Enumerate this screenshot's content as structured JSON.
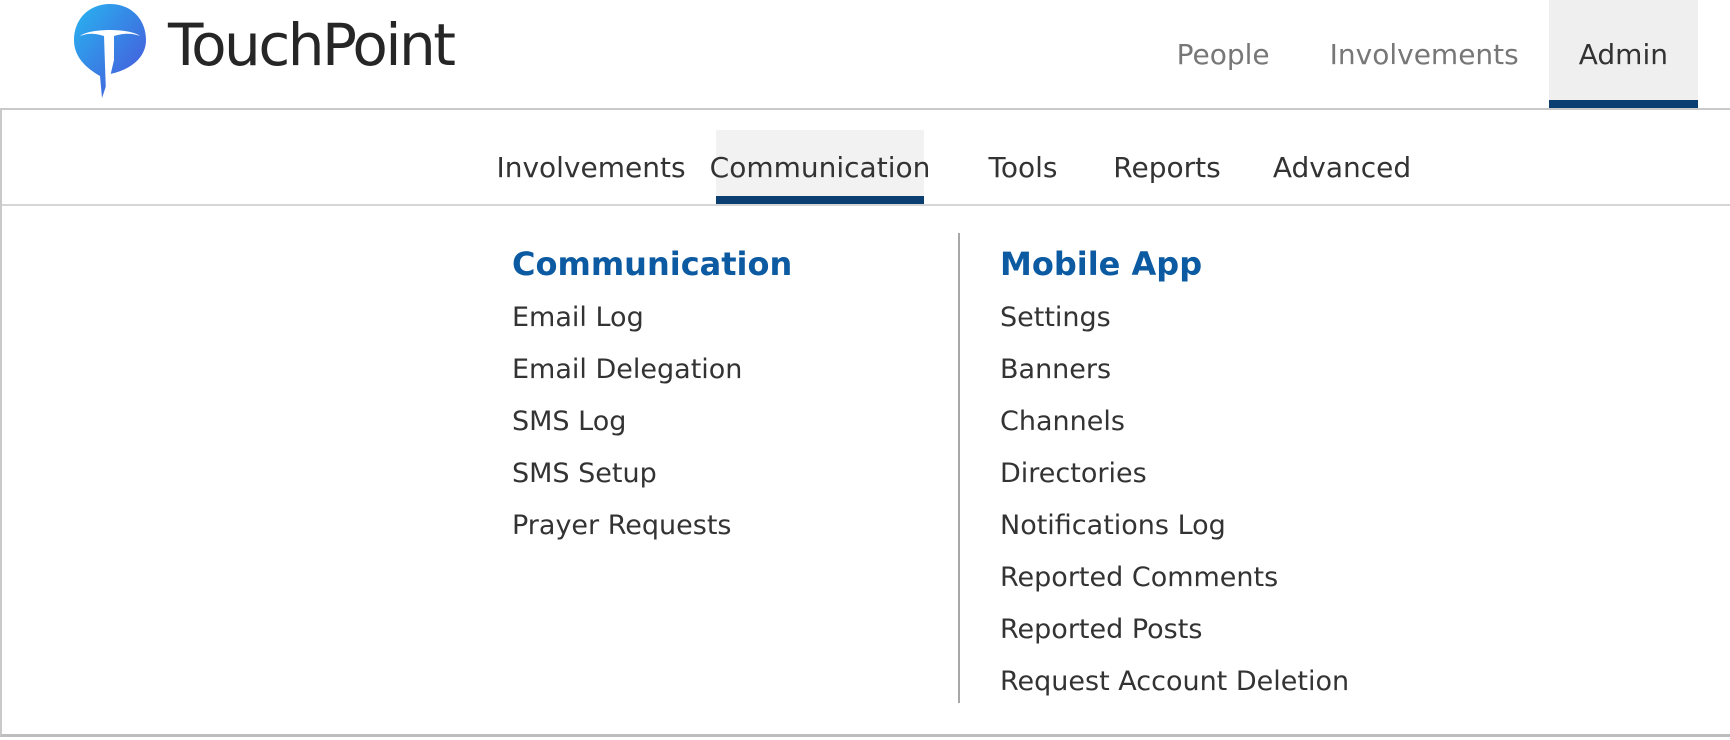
{
  "brand": {
    "name": "TouchPoint",
    "colors": {
      "logo_light": "#27b5f0",
      "logo_dark": "#4a4fd9",
      "accent": "#0b3f72",
      "heading": "#0c5aa1"
    }
  },
  "top_nav": {
    "items": [
      {
        "label": "People"
      },
      {
        "label": "Involvements"
      },
      {
        "label": "Admin",
        "active": true
      }
    ]
  },
  "sub_nav": {
    "items": [
      {
        "label": "Involvements"
      },
      {
        "label": "Communication",
        "active": true
      },
      {
        "label": "Tools"
      },
      {
        "label": "Reports"
      },
      {
        "label": "Advanced"
      }
    ]
  },
  "menu": {
    "columns": [
      {
        "heading": "Communication",
        "links": [
          "Email Log",
          "Email Delegation",
          "SMS Log",
          "SMS Setup",
          "Prayer Requests"
        ]
      },
      {
        "heading": "Mobile App",
        "links": [
          "Settings",
          "Banners",
          "Channels",
          "Directories",
          "Notifications Log",
          "Reported Comments",
          "Reported Posts",
          "Request Account Deletion"
        ]
      }
    ]
  }
}
